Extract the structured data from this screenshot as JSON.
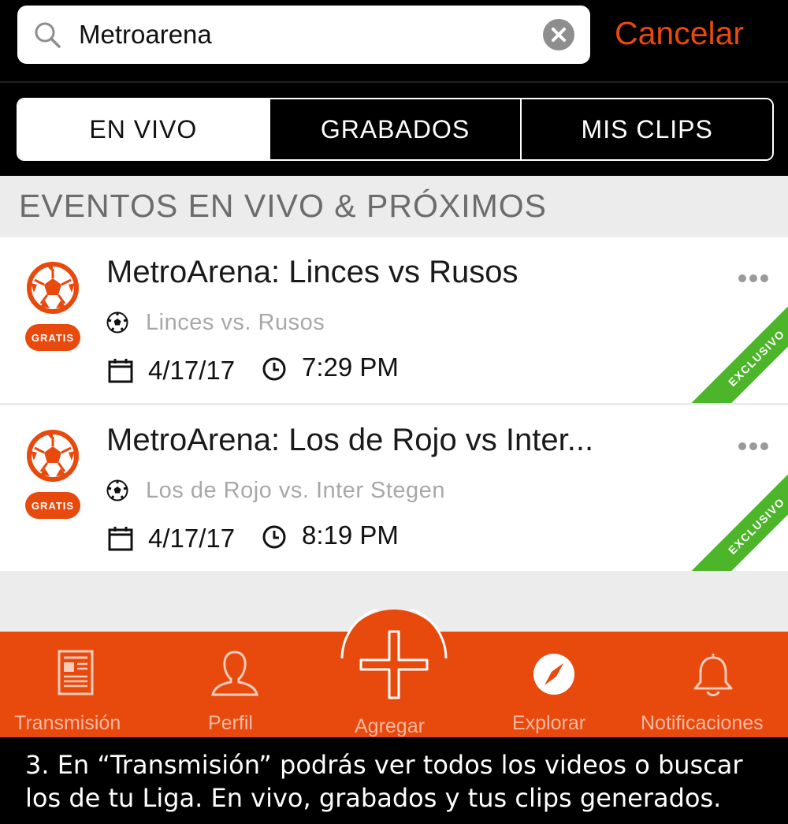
{
  "search": {
    "query": "Metroarena",
    "cancel_label": "Cancelar"
  },
  "tabs": [
    {
      "label": "EN VIVO",
      "active": true
    },
    {
      "label": "GRABADOS",
      "active": false
    },
    {
      "label": "MIS CLIPS",
      "active": false
    }
  ],
  "section": {
    "title": "EVENTOS EN VIVO & PRÓXIMOS"
  },
  "events": [
    {
      "title": "MetroArena: Linces vs Rusos",
      "badge": "GRATIS",
      "match": "Linces vs. Rusos",
      "date": "4/17/17",
      "time": "7:29 PM",
      "ribbon": "EXCLUSIVO"
    },
    {
      "title": "MetroArena: Los de Rojo vs Inter...",
      "badge": "GRATIS",
      "match": "Los de Rojo vs. Inter Stegen",
      "date": "4/17/17",
      "time": "8:19 PM",
      "ribbon": "EXCLUSIVO"
    }
  ],
  "nav": {
    "items": [
      {
        "label": "Transmisión",
        "icon": "newspaper-icon"
      },
      {
        "label": "Perfil",
        "icon": "person-icon"
      },
      {
        "label": "Agregar",
        "icon": "plus-icon"
      },
      {
        "label": "Explorar",
        "icon": "compass-icon"
      },
      {
        "label": "Notificaciones",
        "icon": "bell-icon"
      }
    ]
  },
  "caption": {
    "text": "3. En “Transmisión” podrás ver todos los videos o buscar los de tu Liga.  En vivo, grabados y tus clips generados."
  },
  "colors": {
    "accent": "#e8490d",
    "ribbon": "#4db52a",
    "background": "#ececec"
  }
}
